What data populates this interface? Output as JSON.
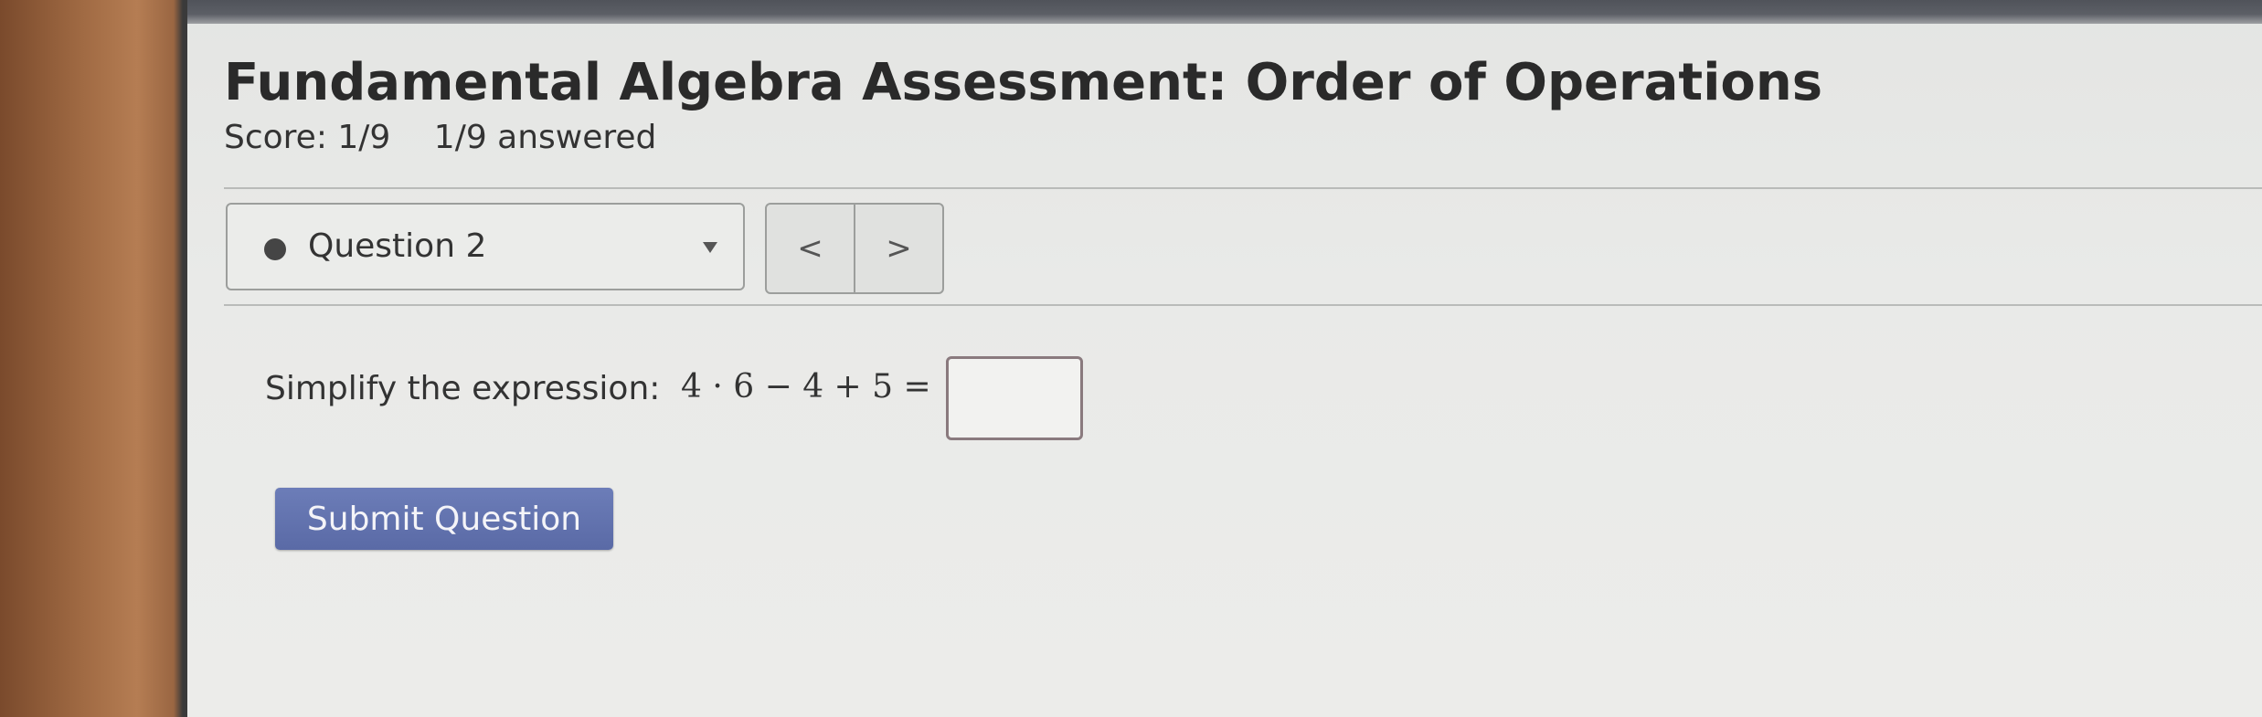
{
  "page": {
    "title": "Fundamental Algebra Assessment: Order of Operations",
    "score": "Score: 1/9",
    "answered": "1/9 answered"
  },
  "question_nav": {
    "selected": "Question 2",
    "prev_label": "<",
    "next_label": ">"
  },
  "question": {
    "prompt": "Simplify the expression:",
    "expression": "4 · 6 − 4 + 5 =",
    "answer_value": ""
  },
  "actions": {
    "submit_label": "Submit Question"
  },
  "colors": {
    "submit_button": "#5f70ad",
    "status_dot": "#454545",
    "background": "#e9eae8"
  },
  "icons": {
    "status": "status-dot-icon",
    "dropdown": "caret-down-icon",
    "prev": "chevron-left-icon",
    "next": "chevron-right-icon"
  }
}
